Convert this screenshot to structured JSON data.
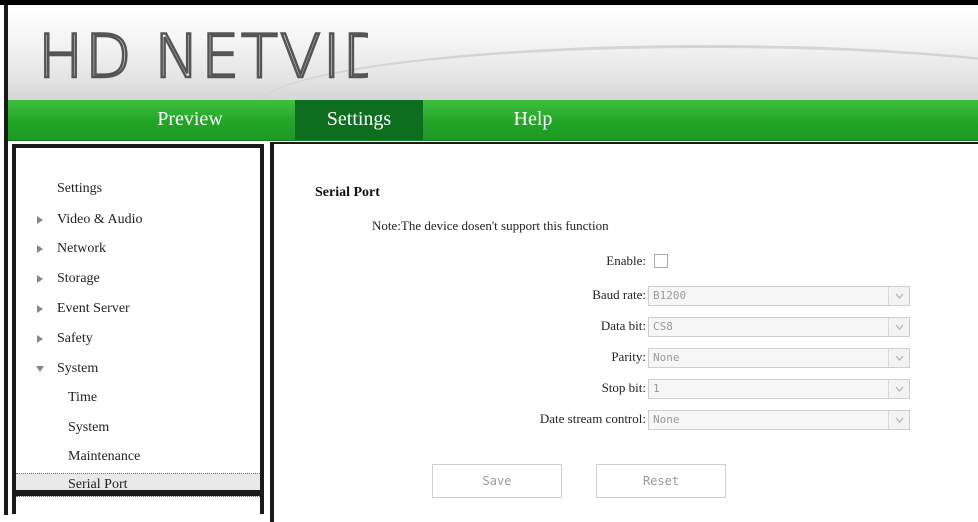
{
  "header": {
    "logo_text": "HD NETVIDEO"
  },
  "nav": {
    "tabs": [
      "Preview",
      "Settings",
      "Help"
    ],
    "active": "Settings"
  },
  "sidebar": {
    "heading": "Settings",
    "items": [
      {
        "label": "Video & Audio",
        "expanded": false
      },
      {
        "label": "Network",
        "expanded": false
      },
      {
        "label": "Storage",
        "expanded": false
      },
      {
        "label": "Event Server",
        "expanded": false
      },
      {
        "label": "Safety",
        "expanded": false
      },
      {
        "label": "System",
        "expanded": true
      }
    ],
    "subitems": [
      "Time",
      "System",
      "Maintenance",
      "Serial Port"
    ],
    "selected_subitem": "Serial Port"
  },
  "content": {
    "title": "Serial Port",
    "note": "Note:The device dosen't support this function",
    "fields": {
      "enable_label": "Enable:",
      "baud_label": "Baud rate:",
      "baud_value": "B1200",
      "databit_label": "Data bit:",
      "databit_value": "CS8",
      "parity_label": "Parity:",
      "parity_value": "None",
      "stopbit_label": "Stop bit:",
      "stopbit_value": "1",
      "flow_label": "Date stream control:",
      "flow_value": "None"
    },
    "buttons": {
      "save": "Save",
      "reset": "Reset"
    }
  },
  "colors": {
    "nav_green": "#22a526",
    "nav_active": "#0d6e1f",
    "border": "#1a1a1a"
  }
}
